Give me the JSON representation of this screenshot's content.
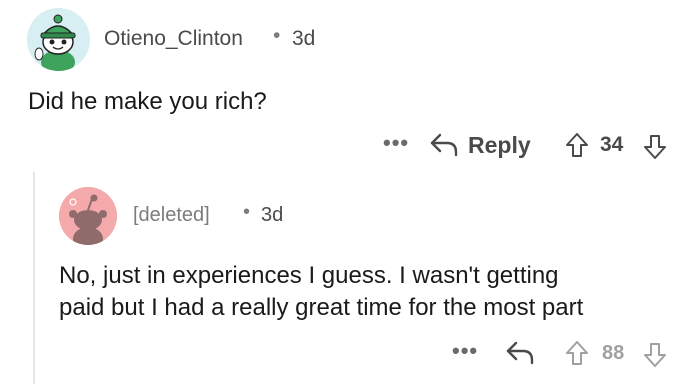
{
  "comment": {
    "username": "Otieno_Clinton",
    "separator": "•",
    "age": "3d",
    "body": "Did he make you rich?",
    "actions": {
      "more": "•••",
      "reply_label": "Reply",
      "score": "34"
    }
  },
  "reply": {
    "username": "[deleted]",
    "separator": "•",
    "age": "3d",
    "body_lines": [
      "No, just in experiences I guess. I wasn't getting",
      "paid but I had a really great time for the most part"
    ],
    "actions": {
      "more": "•••",
      "score": "88"
    }
  },
  "colors": {
    "avatar_top_bg": "#d7eef2",
    "avatar_reply_bg": "#f4a9aa",
    "thread_line": "#e6e6e6"
  },
  "icons": {
    "top_avatar": "snoo-avatar-green-hat",
    "reply_avatar": "snoo-avatar-deleted",
    "reply": "reply-arrow-icon",
    "upvote": "upvote-arrow-icon",
    "downvote": "downvote-arrow-icon"
  }
}
